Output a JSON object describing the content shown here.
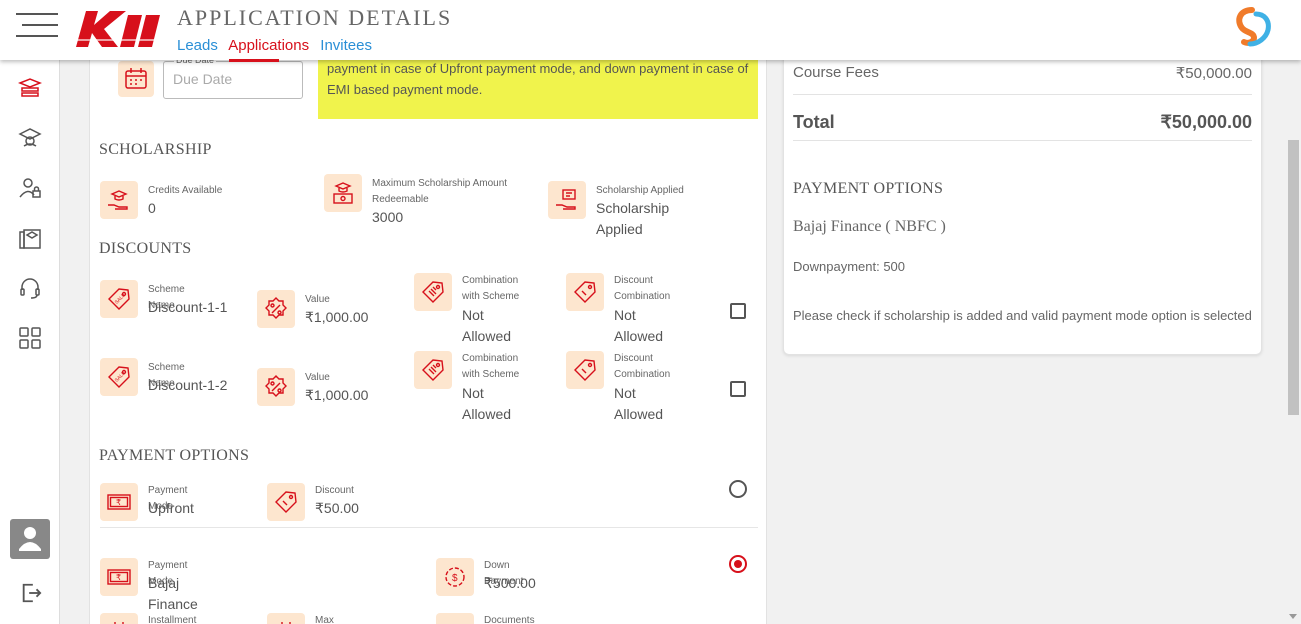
{
  "header": {
    "title": "APPLICATION DETAILS",
    "nav": [
      "Leads",
      "Applications",
      "Invitees"
    ],
    "active_nav": "Applications",
    "logo_text": "Kii"
  },
  "sidebar": {
    "icons": [
      "graduation-cap-stack-icon",
      "school-icon",
      "user-lock-icon",
      "library-icon",
      "headset-icon",
      "dashboard-grid-icon"
    ],
    "bottom": [
      "avatar",
      "logout-icon"
    ]
  },
  "due_date": {
    "label": "Due Date",
    "placeholder": "Due Date",
    "note": "Payment due date by which student is supposed to make the full payment in case of Upfront payment mode, and down payment in case of EMI based payment mode."
  },
  "scholarship": {
    "title": "SCHOLARSHIP",
    "items": [
      {
        "label": "Credits Available",
        "value": "0",
        "icon": "hand-cap-icon"
      },
      {
        "label": "Maximum Scholarship Amount Redeemable",
        "value": "3000",
        "icon": "cap-money-icon"
      },
      {
        "label": "Scholarship Applied",
        "value": "Scholarship Applied",
        "icon": "hand-certificate-icon"
      }
    ]
  },
  "discounts": {
    "title": "DISCOUNTS",
    "rows": [
      {
        "scheme_label": "Scheme Name",
        "scheme_value": "Discount-1-1",
        "value_label": "Value",
        "value": "₹1,000.00",
        "combo_scheme_label": "Combination with Scheme",
        "combo_scheme_value": "Not Allowed",
        "combo_disc_label": "Discount Combination",
        "combo_disc_value": "Not Allowed"
      },
      {
        "scheme_label": "Scheme Name",
        "scheme_value": "Discount-1-2",
        "value_label": "Value",
        "value": "₹1,000.00",
        "combo_scheme_label": "Combination with Scheme",
        "combo_scheme_value": "Not Allowed",
        "combo_disc_label": "Discount Combination",
        "combo_disc_value": "Not Allowed"
      }
    ]
  },
  "payment_options": {
    "title": "PAYMENT OPTIONS",
    "upfront": {
      "mode_label": "Payment Mode",
      "mode_value": "Upfront",
      "disc_label": "Discount",
      "disc_value": "₹50.00"
    },
    "finance": {
      "mode_label": "Payment Mode",
      "mode_value": "Bajaj Finance",
      "down_label": "Down Payment",
      "down_value": "₹500.00",
      "installment_type_label": "Installment Type",
      "max_installments_label": "Max Installments",
      "documents_label": "Documents"
    }
  },
  "summary": {
    "course_fees_label": "Course Fees",
    "course_fees_value": "₹50,000.00",
    "total_label": "Total",
    "total_value": "₹50,000.00",
    "payment_options_title": "PAYMENT OPTIONS",
    "provider": "Bajaj Finance ( NBFC )",
    "downpayment": "Downpayment: 500",
    "check_note": "Please check if scholarship is added and valid payment mode option is selected"
  },
  "colors": {
    "accent": "#d7101b",
    "link": "#2a8fd6",
    "icon_bg": "#fde6cf",
    "highlight": "#f0f34c"
  }
}
